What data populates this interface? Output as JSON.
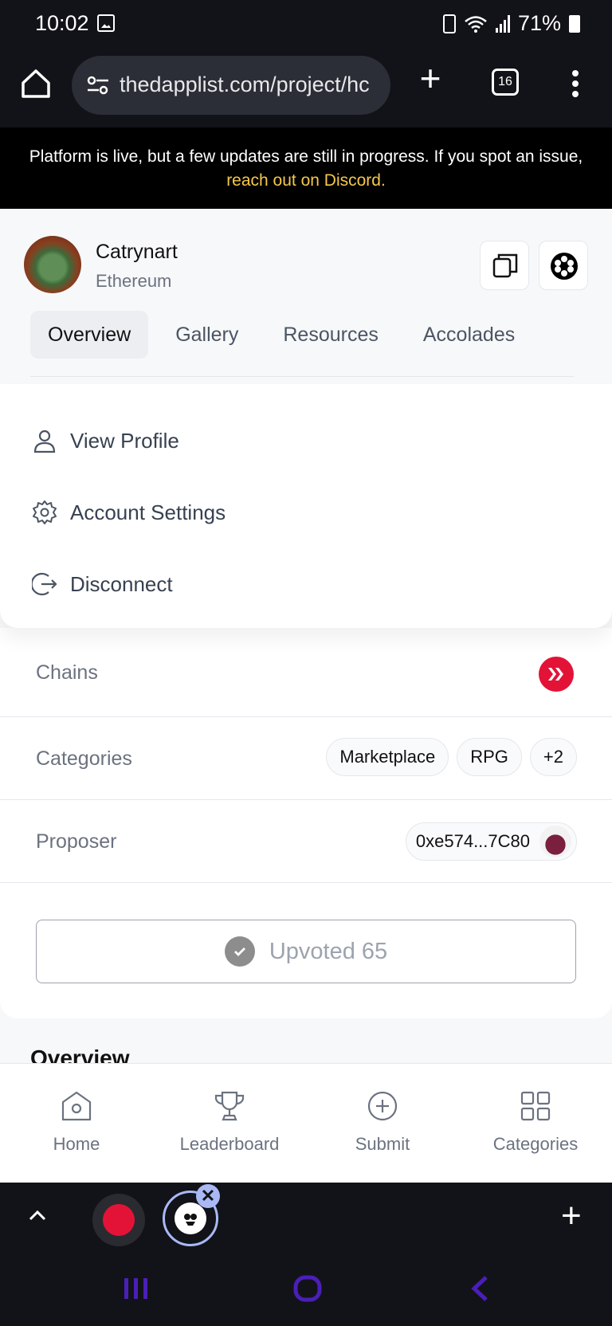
{
  "status_bar": {
    "time": "10:02",
    "battery": "71%"
  },
  "browser": {
    "url": "thedapplist.com/project/hc",
    "tab_count": "16"
  },
  "banner": {
    "text": "Platform is live, but a few updates are still in progress. If you spot an issue, ",
    "link": "reach out on Discord."
  },
  "project": {
    "name": "Catrynart",
    "chain": "Ethereum",
    "tabs": [
      "Overview",
      "Gallery",
      "Resources",
      "Accolades"
    ],
    "active_tab": "Overview"
  },
  "account_menu": {
    "items": [
      {
        "label": "View Profile",
        "icon": "user-icon"
      },
      {
        "label": "Account Settings",
        "icon": "gear-icon"
      },
      {
        "label": "Disconnect",
        "icon": "logout-icon"
      }
    ]
  },
  "details": {
    "chains_label": "Chains",
    "categories_label": "Categories",
    "categories": [
      "Marketplace",
      "RPG",
      "+2"
    ],
    "proposer_label": "Proposer",
    "proposer_address": "0xe574...7C80",
    "upvote_label": "Upvoted 65"
  },
  "section_heading": "Overview",
  "bottom_nav": {
    "items": [
      {
        "label": "Home",
        "icon": "home-icon"
      },
      {
        "label": "Leaderboard",
        "icon": "trophy-icon"
      },
      {
        "label": "Submit",
        "icon": "plus-circle-icon"
      },
      {
        "label": "Categories",
        "icon": "grid-icon"
      }
    ]
  },
  "colors": {
    "hive_red": "#e31337",
    "banner_link": "#f5c74a",
    "system_nav": "#4a1fb8"
  }
}
